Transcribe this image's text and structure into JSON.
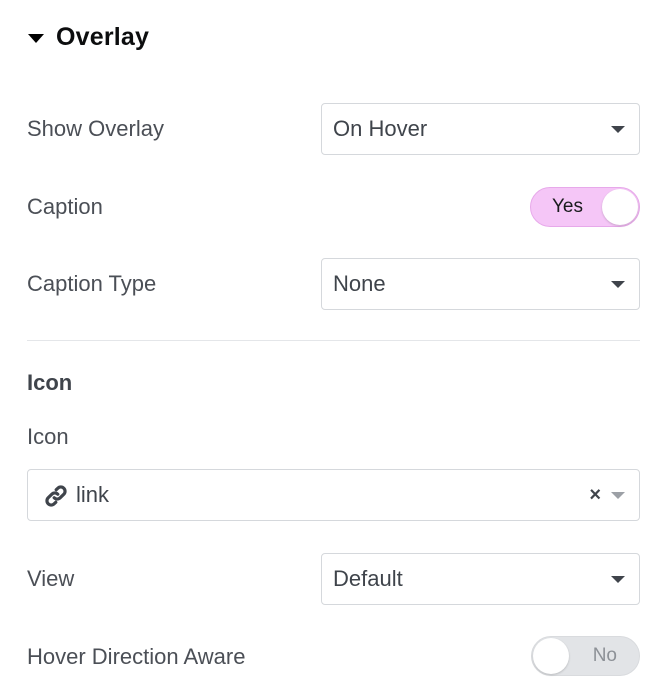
{
  "section": {
    "title": "Overlay"
  },
  "show_overlay": {
    "label": "Show Overlay",
    "value": "On Hover"
  },
  "caption": {
    "label": "Caption",
    "toggle": "Yes",
    "enabled": true
  },
  "caption_type": {
    "label": "Caption Type",
    "value": "None"
  },
  "icon_group": {
    "heading": "Icon",
    "label": "Icon",
    "value": "link",
    "icon": "link-icon",
    "clear": "×"
  },
  "view": {
    "label": "View",
    "value": "Default"
  },
  "hover_direction": {
    "label": "Hover Direction Aware",
    "toggle": "No",
    "enabled": false
  },
  "colors": {
    "toggle_on": "#f5c6f7",
    "toggle_off": "#e2e4e7",
    "border": "#d5d8dc",
    "text": "#3f444b"
  }
}
